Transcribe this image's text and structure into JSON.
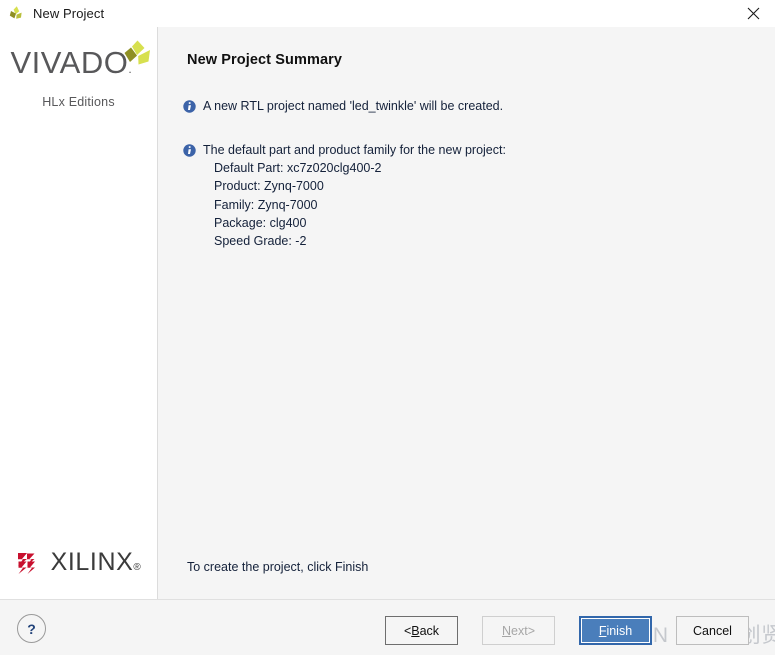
{
  "window": {
    "title": "New Project",
    "icon": "vivado-leaf-icon",
    "close_label": "close-icon"
  },
  "sidebar": {
    "product_name": "VIVADO",
    "product_name_dot": ".",
    "product_edition": "HLx Editions",
    "vendor_name": "XILINX",
    "vendor_reg": "®",
    "brand_colors": {
      "vivado_text": "#58585a",
      "leaf_dark": "#8f9024",
      "leaf_light": "#d7e04f",
      "xilinx_red": "#c8102e",
      "xilinx_text": "#3b3b3b"
    }
  },
  "main": {
    "page_title": "New Project Summary",
    "info_primary": "A new RTL project named 'led_twinkle' will be created.",
    "info_secondary_heading": "The default part and product family for the new project:",
    "details": [
      "Default Part: xc7z020clg400-2",
      "Product: Zynq-7000",
      "Family: Zynq-7000",
      "Package: clg400",
      "Speed Grade: -2"
    ],
    "footer_note": "To create the project, click Finish",
    "info_icon_color": "#3c63a8"
  },
  "buttons": {
    "help": "?",
    "back": {
      "prefix": "< ",
      "accel": "B",
      "rest": "ack",
      "state": "enabled"
    },
    "next": {
      "accel": "N",
      "rest": "ext",
      "suffix": " >",
      "state": "disabled"
    },
    "finish": {
      "accel": "F",
      "rest": "inish",
      "state": "default-focused"
    },
    "cancel": {
      "label": "Cancel",
      "state": "enabled"
    },
    "primary_color": "#4a7ebb",
    "primary_border": "#3267ab"
  },
  "watermark": {
    "text": "CSDN @四岸创贤"
  }
}
